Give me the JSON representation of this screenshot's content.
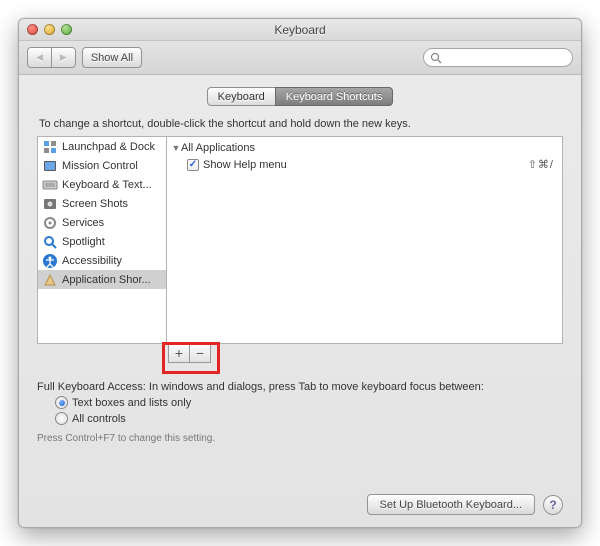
{
  "window": {
    "title": "Keyboard"
  },
  "toolbar": {
    "back_icon": "◀",
    "fwd_icon": "▶",
    "show_all": "Show All",
    "search_placeholder": ""
  },
  "tabs": {
    "keyboard": "Keyboard",
    "shortcuts": "Keyboard Shortcuts"
  },
  "instruction": "To change a shortcut, double-click the shortcut and hold down the new keys.",
  "sidebar": {
    "items": [
      {
        "label": "Launchpad & Dock",
        "icon": "launchpad"
      },
      {
        "label": "Mission Control",
        "icon": "mission"
      },
      {
        "label": "Keyboard & Text...",
        "icon": "keyboard"
      },
      {
        "label": "Screen Shots",
        "icon": "screenshot"
      },
      {
        "label": "Services",
        "icon": "services"
      },
      {
        "label": "Spotlight",
        "icon": "spotlight"
      },
      {
        "label": "Accessibility",
        "icon": "accessibility"
      },
      {
        "label": "Application Shor...",
        "icon": "appshortcuts",
        "selected": true
      }
    ]
  },
  "shortcuts_tree": {
    "group": "All Applications",
    "items": [
      {
        "checked": true,
        "label": "Show Help menu",
        "shortcut": "⇧⌘/"
      }
    ]
  },
  "buttons": {
    "add": "+",
    "remove": "−"
  },
  "access": {
    "prompt": "Full Keyboard Access: In windows and dialogs, press Tab to move keyboard focus between:",
    "opt1": "Text boxes and lists only",
    "opt2": "All controls",
    "hint": "Press Control+F7 to change this setting."
  },
  "footer": {
    "bluetooth": "Set Up Bluetooth Keyboard...",
    "help": "?"
  }
}
